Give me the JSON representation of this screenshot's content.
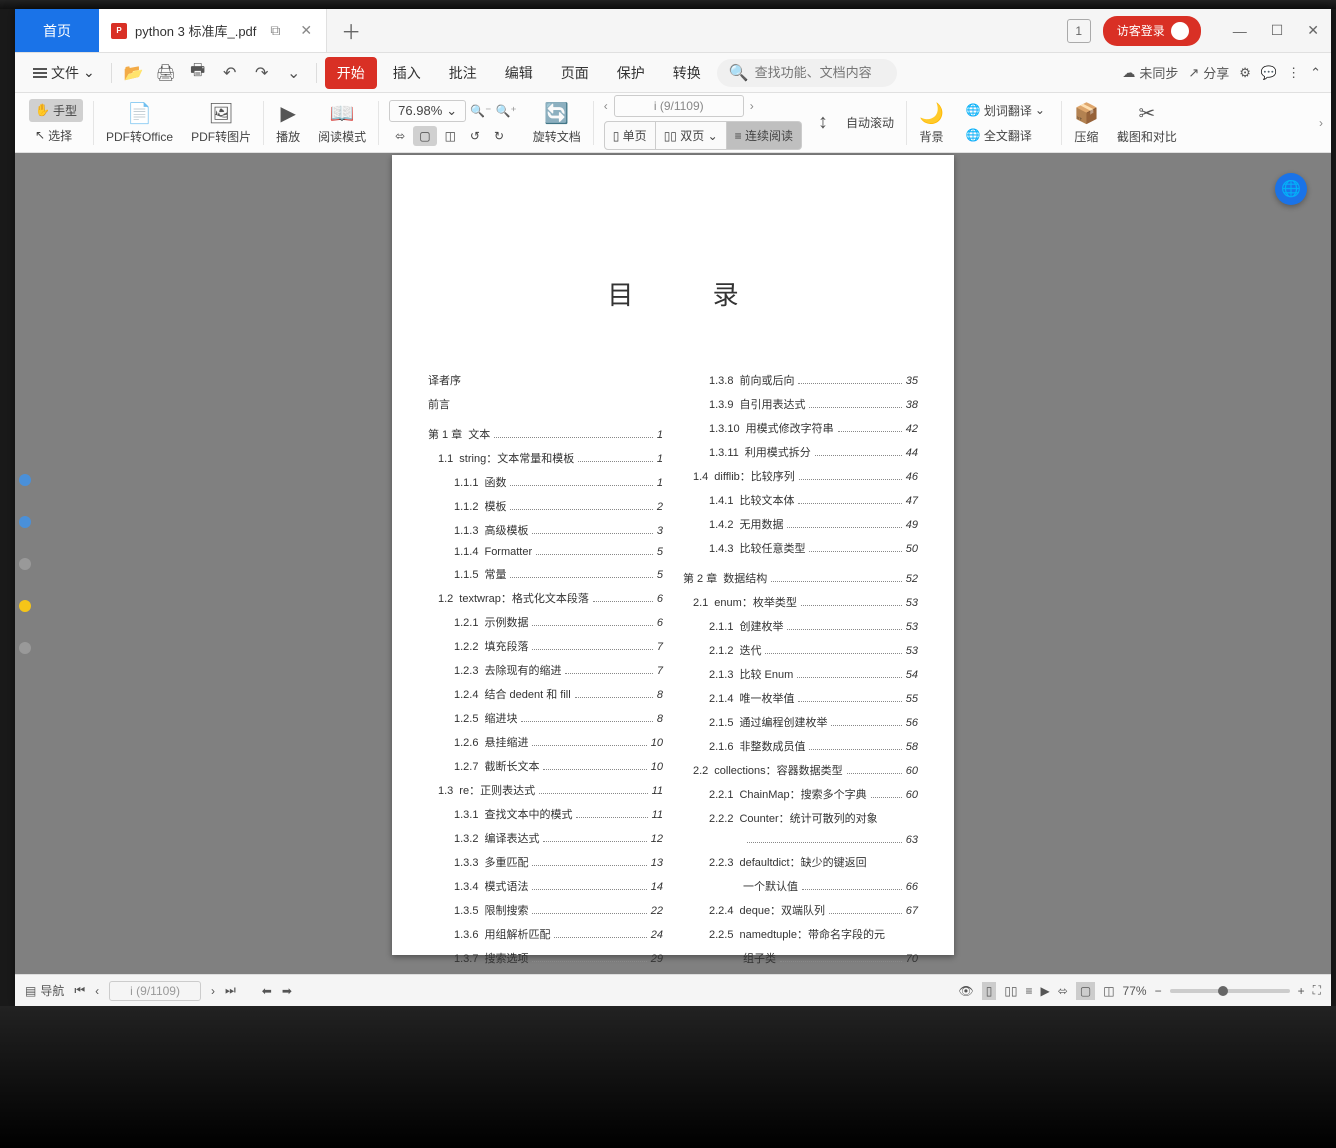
{
  "tabs": {
    "home": "首页",
    "filename": "python 3 标准库_.pdf"
  },
  "titlebar": {
    "window_num": "1",
    "guest_login": "访客登录"
  },
  "menubar": {
    "file": "文件",
    "tabs": {
      "start": "开始",
      "insert": "插入",
      "review": "批注",
      "edit": "编辑",
      "page": "页面",
      "protect": "保护",
      "convert": "转换"
    },
    "search_placeholder": "查找功能、文档内容",
    "unsync": "未同步",
    "share": "分享"
  },
  "toolbar": {
    "hand": "手型",
    "select": "选择",
    "pdf_office": "PDF转Office",
    "pdf_img": "PDF转图片",
    "play": "播放",
    "readmode": "阅读模式",
    "zoom": "76.98%",
    "page_of": "i (9/1109)",
    "rotate": "旋转文档",
    "single": "单页",
    "double": "双页",
    "continuous": "连续阅读",
    "autoscroll": "自动滚动",
    "background": "背景",
    "word_trans": "划词翻译",
    "full_trans": "全文翻译",
    "compress": "压缩",
    "crop": "截图和对比"
  },
  "status": {
    "nav": "导航",
    "page": "i (9/1109)",
    "zoom": "77%"
  },
  "toc": {
    "title": "目 录",
    "left": [
      {
        "ind": 0,
        "n": "",
        "t": "译者序",
        "p": ""
      },
      {
        "ind": 0,
        "n": "",
        "t": "前言",
        "p": ""
      },
      {
        "ind": 0,
        "n": "第 1 章",
        "t": "文本",
        "p": "1",
        "chapter": true
      },
      {
        "ind": 1,
        "n": "1.1",
        "t": "string：文本常量和模板",
        "p": "1"
      },
      {
        "ind": 2,
        "n": "1.1.1",
        "t": "函数",
        "p": "1"
      },
      {
        "ind": 2,
        "n": "1.1.2",
        "t": "模板",
        "p": "2"
      },
      {
        "ind": 2,
        "n": "1.1.3",
        "t": "高级模板",
        "p": "3"
      },
      {
        "ind": 2,
        "n": "1.1.4",
        "t": "Formatter",
        "p": "5"
      },
      {
        "ind": 2,
        "n": "1.1.5",
        "t": "常量",
        "p": "5"
      },
      {
        "ind": 1,
        "n": "1.2",
        "t": "textwrap：格式化文本段落",
        "p": "6"
      },
      {
        "ind": 2,
        "n": "1.2.1",
        "t": "示例数据",
        "p": "6"
      },
      {
        "ind": 2,
        "n": "1.2.2",
        "t": "填充段落",
        "p": "7"
      },
      {
        "ind": 2,
        "n": "1.2.3",
        "t": "去除现有的缩进",
        "p": "7"
      },
      {
        "ind": 2,
        "n": "1.2.4",
        "t": "结合 dedent 和 fill",
        "p": "8"
      },
      {
        "ind": 2,
        "n": "1.2.5",
        "t": "缩进块",
        "p": "8"
      },
      {
        "ind": 2,
        "n": "1.2.6",
        "t": "悬挂缩进",
        "p": "10"
      },
      {
        "ind": 2,
        "n": "1.2.7",
        "t": "截断长文本",
        "p": "10"
      },
      {
        "ind": 1,
        "n": "1.3",
        "t": "re：正则表达式",
        "p": "11"
      },
      {
        "ind": 2,
        "n": "1.3.1",
        "t": "查找文本中的模式",
        "p": "11"
      },
      {
        "ind": 2,
        "n": "1.3.2",
        "t": "编译表达式",
        "p": "12"
      },
      {
        "ind": 2,
        "n": "1.3.3",
        "t": "多重匹配",
        "p": "13"
      },
      {
        "ind": 2,
        "n": "1.3.4",
        "t": "模式语法",
        "p": "14"
      },
      {
        "ind": 2,
        "n": "1.3.5",
        "t": "限制搜索",
        "p": "22"
      },
      {
        "ind": 2,
        "n": "1.3.6",
        "t": "用组解析匹配",
        "p": "24"
      },
      {
        "ind": 2,
        "n": "1.3.7",
        "t": "搜索选项",
        "p": "29"
      }
    ],
    "right": [
      {
        "ind": 2,
        "n": "1.3.8",
        "t": "前向或后向",
        "p": "35"
      },
      {
        "ind": 2,
        "n": "1.3.9",
        "t": "自引用表达式",
        "p": "38"
      },
      {
        "ind": 2,
        "n": "1.3.10",
        "t": "用模式修改字符串",
        "p": "42"
      },
      {
        "ind": 2,
        "n": "1.3.11",
        "t": "利用模式拆分",
        "p": "44"
      },
      {
        "ind": 1,
        "n": "1.4",
        "t": "difflib：比较序列",
        "p": "46"
      },
      {
        "ind": 2,
        "n": "1.4.1",
        "t": "比较文本体",
        "p": "47"
      },
      {
        "ind": 2,
        "n": "1.4.2",
        "t": "无用数据",
        "p": "49"
      },
      {
        "ind": 2,
        "n": "1.4.3",
        "t": "比较任意类型",
        "p": "50"
      },
      {
        "ind": 0,
        "n": "第 2 章",
        "t": "数据结构",
        "p": "52",
        "chapter": true
      },
      {
        "ind": 1,
        "n": "2.1",
        "t": "enum：枚举类型",
        "p": "53"
      },
      {
        "ind": 2,
        "n": "2.1.1",
        "t": "创建枚举",
        "p": "53"
      },
      {
        "ind": 2,
        "n": "2.1.2",
        "t": "迭代",
        "p": "53"
      },
      {
        "ind": 2,
        "n": "2.1.3",
        "t": "比较 Enum",
        "p": "54"
      },
      {
        "ind": 2,
        "n": "2.1.4",
        "t": "唯一枚举值",
        "p": "55"
      },
      {
        "ind": 2,
        "n": "2.1.5",
        "t": "通过编程创建枚举",
        "p": "56"
      },
      {
        "ind": 2,
        "n": "2.1.6",
        "t": "非整数成员值",
        "p": "58"
      },
      {
        "ind": 1,
        "n": "2.2",
        "t": "collections：容器数据类型",
        "p": "60"
      },
      {
        "ind": 2,
        "n": "2.2.1",
        "t": "ChainMap：搜索多个字典",
        "p": "60"
      },
      {
        "ind": 2,
        "n": "2.2.2",
        "t": "Counter：统计可散列的对象",
        "p": "63",
        "wrap": true
      },
      {
        "ind": 2,
        "n": "2.2.3",
        "t": "defaultdict：缺少的键返回一个默认值",
        "p": "66",
        "wrap": true
      },
      {
        "ind": 2,
        "n": "2.2.4",
        "t": "deque：双端队列",
        "p": "67"
      },
      {
        "ind": 2,
        "n": "2.2.5",
        "t": "namedtuple：带命名字段的元组子类",
        "p": "70",
        "wrap": true
      }
    ]
  }
}
